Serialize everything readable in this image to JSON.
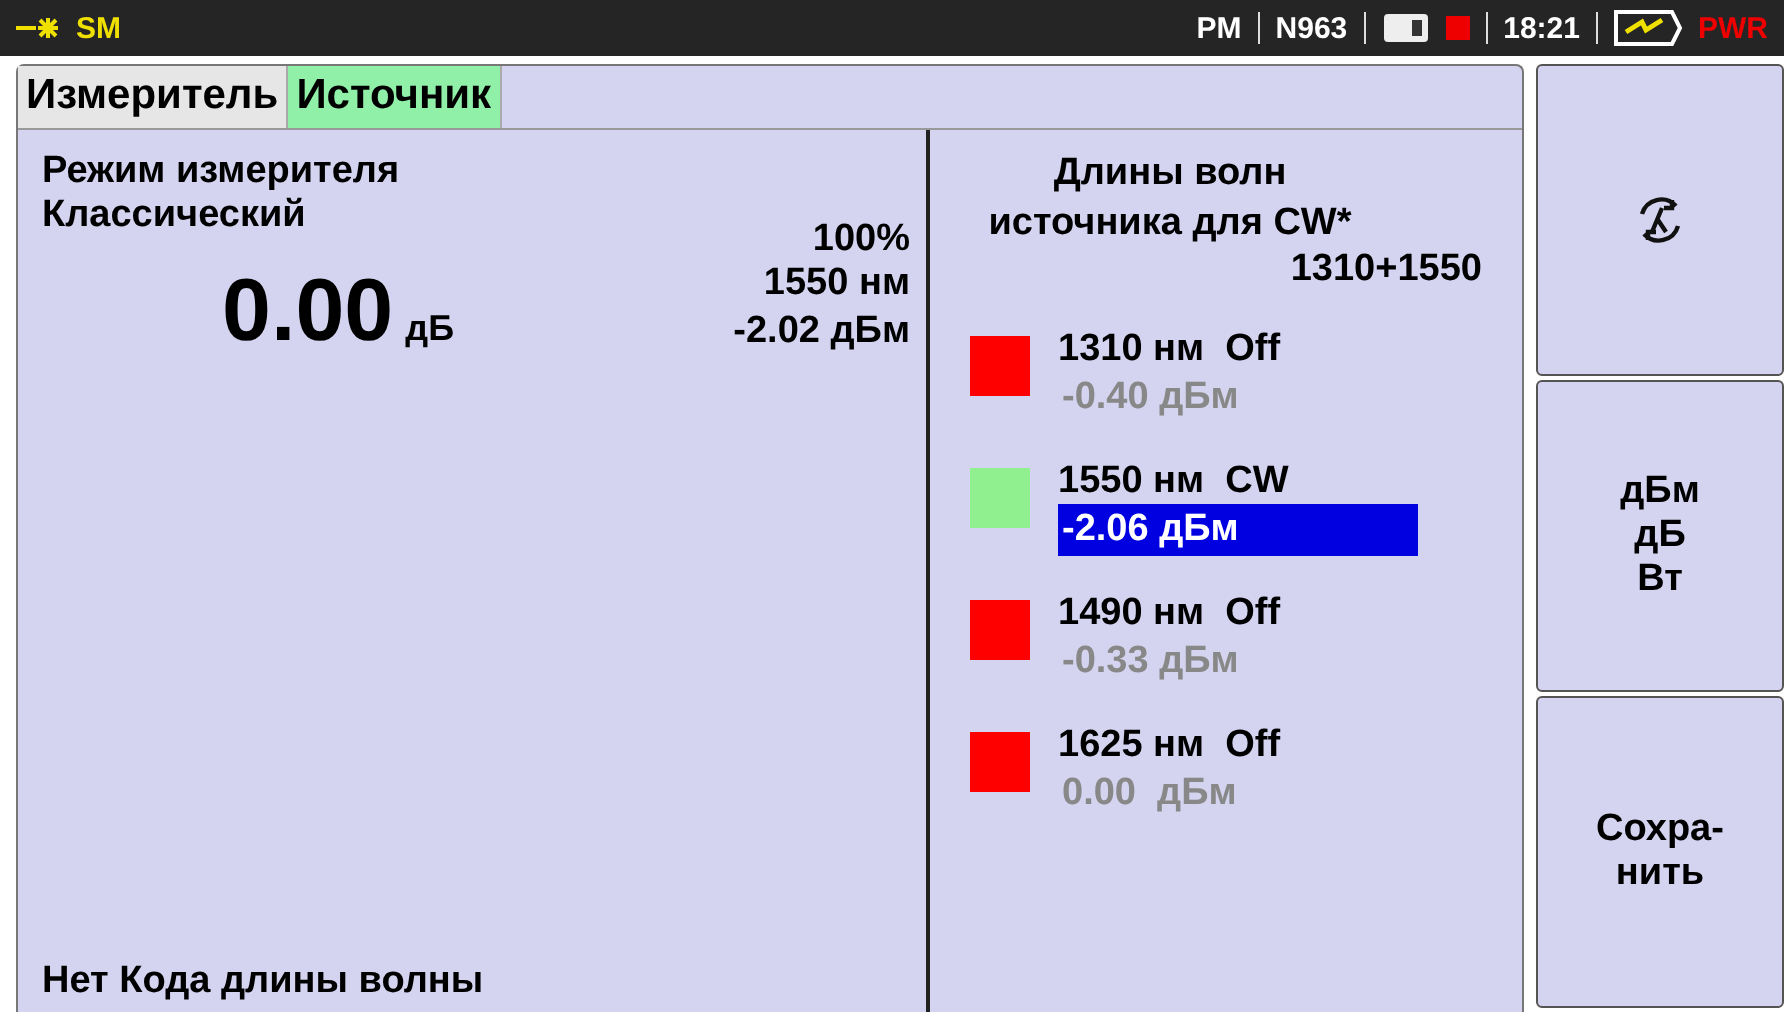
{
  "status_bar": {
    "mode": "SM",
    "module": "PM",
    "device": "N963",
    "time": "18:21",
    "power": "PWR"
  },
  "tabs": [
    {
      "label": "Измеритель",
      "selected": false
    },
    {
      "label": "Источник",
      "selected": true
    }
  ],
  "meter": {
    "mode_label": "Режим измерителя",
    "mode_value": "Классический",
    "value": "0.00",
    "unit": "дБ",
    "percent": "100%",
    "wavelength": "1550 нм",
    "power": "-2.02 дБм",
    "footer": "Нет Кода длины волны"
  },
  "source": {
    "title": "Длины волн источника для CW*",
    "combo": "1310+1550",
    "wavelengths": [
      {
        "label": "1310 нм",
        "mode": "Off",
        "reading": "-0.40 дБм",
        "color": "#ff0000",
        "selected": false
      },
      {
        "label": "1550 нм",
        "mode": "CW",
        "reading": "-2.06 дБм",
        "color": "#90f090",
        "selected": true
      },
      {
        "label": "1490 нм",
        "mode": "Off",
        "reading": "-0.33 дБм",
        "color": "#ff0000",
        "selected": false
      },
      {
        "label": "1625 нм",
        "mode": "Off",
        "reading": "0.00  дБм",
        "color": "#ff0000",
        "selected": false
      }
    ]
  },
  "side_buttons": [
    {
      "kind": "icon"
    },
    {
      "kind": "text",
      "lines": [
        "дБм",
        "дБ",
        "Вт"
      ]
    },
    {
      "kind": "text",
      "lines": [
        "Сохра-",
        "нить"
      ]
    }
  ]
}
